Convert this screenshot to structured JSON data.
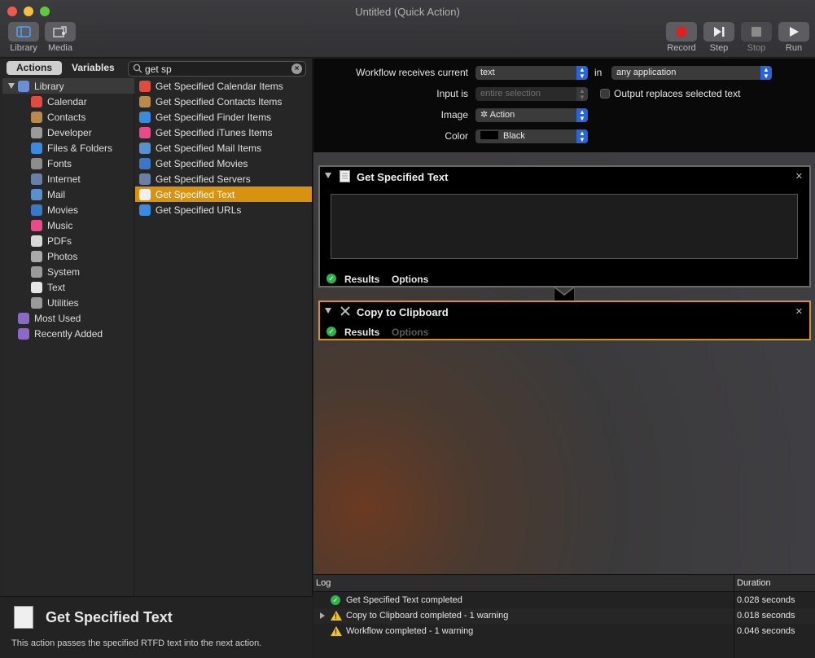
{
  "window": {
    "title": "Untitled (Quick Action)"
  },
  "toolbar": {
    "library_label": "Library",
    "media_label": "Media",
    "record_label": "Record",
    "step_label": "Step",
    "stop_label": "Stop",
    "run_label": "Run"
  },
  "left": {
    "tabs": {
      "actions": "Actions",
      "variables": "Variables"
    },
    "search": {
      "value": "get sp",
      "placeholder": "Search"
    },
    "library": [
      {
        "label": "Library",
        "icon": "library-icon",
        "color": "#6a8fd6"
      },
      {
        "label": "Calendar",
        "icon": "calendar-icon",
        "color": "#e04a3f"
      },
      {
        "label": "Contacts",
        "icon": "contacts-icon",
        "color": "#b98a4a"
      },
      {
        "label": "Developer",
        "icon": "developer-icon",
        "color": "#9a9a9a"
      },
      {
        "label": "Files & Folders",
        "icon": "finder-icon",
        "color": "#3a8be0"
      },
      {
        "label": "Fonts",
        "icon": "fonts-icon",
        "color": "#8c8c8c"
      },
      {
        "label": "Internet",
        "icon": "internet-icon",
        "color": "#6a7fa8"
      },
      {
        "label": "Mail",
        "icon": "mail-icon",
        "color": "#5a8fd0"
      },
      {
        "label": "Movies",
        "icon": "movies-icon",
        "color": "#3b78c4"
      },
      {
        "label": "Music",
        "icon": "music-icon",
        "color": "#e84a8a"
      },
      {
        "label": "PDFs",
        "icon": "pdf-icon",
        "color": "#d8d8d8"
      },
      {
        "label": "Photos",
        "icon": "photos-icon",
        "color": "#aaaaaa"
      },
      {
        "label": "System",
        "icon": "system-icon",
        "color": "#9a9a9a"
      },
      {
        "label": "Text",
        "icon": "text-icon",
        "color": "#e5e5e5"
      },
      {
        "label": "Utilities",
        "icon": "utilities-icon",
        "color": "#9a9a9a"
      },
      {
        "label": "Most Used",
        "icon": "most-used-icon",
        "color": "#8a6ac4"
      },
      {
        "label": "Recently Added",
        "icon": "recently-added-icon",
        "color": "#8a6ac4"
      }
    ],
    "actions": [
      {
        "label": "Get Specified Calendar Items",
        "color": "#e04a3f"
      },
      {
        "label": "Get Specified Contacts Items",
        "color": "#b98a4a"
      },
      {
        "label": "Get Specified Finder Items",
        "color": "#3a8be0"
      },
      {
        "label": "Get Specified iTunes Items",
        "color": "#e84a8a"
      },
      {
        "label": "Get Specified Mail Items",
        "color": "#5a8fd0"
      },
      {
        "label": "Get Specified Movies",
        "color": "#3b78c4"
      },
      {
        "label": "Get Specified Servers",
        "color": "#6a7fa8"
      },
      {
        "label": "Get Specified Text",
        "color": "#efefef"
      },
      {
        "label": "Get Specified URLs",
        "color": "#3a8be0"
      }
    ],
    "selected_action": "Get Specified Text",
    "description": {
      "title": "Get Specified Text",
      "text": "This action passes the specified RTFD text into the next action."
    }
  },
  "workflow": {
    "receives_label": "Workflow receives current",
    "receives_value": "text",
    "in_label": "in",
    "in_value": "any application",
    "input_label": "Input is",
    "input_value": "entire selection",
    "output_replaces_label": "Output replaces selected text",
    "image_label": "Image",
    "image_value": "Action",
    "color_label": "Color",
    "color_value": "Black"
  },
  "actions_in_workflow": [
    {
      "title": "Get Specified Text",
      "results": "Results",
      "options": "Options"
    },
    {
      "title": "Copy to Clipboard",
      "results": "Results",
      "options": "Options"
    }
  ],
  "log": {
    "log_header": "Log",
    "duration_header": "Duration",
    "rows": [
      {
        "text": "Get Specified Text completed",
        "duration": "0.028 seconds",
        "status": "ok"
      },
      {
        "text": "Copy to Clipboard completed - 1 warning",
        "duration": "0.018 seconds",
        "status": "warning"
      },
      {
        "text": "Workflow completed - 1 warning",
        "duration": "0.046 seconds",
        "status": "warning"
      }
    ]
  },
  "colors": {
    "accent": "#d8920f",
    "popup_arrow": "#2b63d9",
    "ok": "#2fb34d",
    "warning": "#f3c418",
    "record": "#e02020"
  }
}
